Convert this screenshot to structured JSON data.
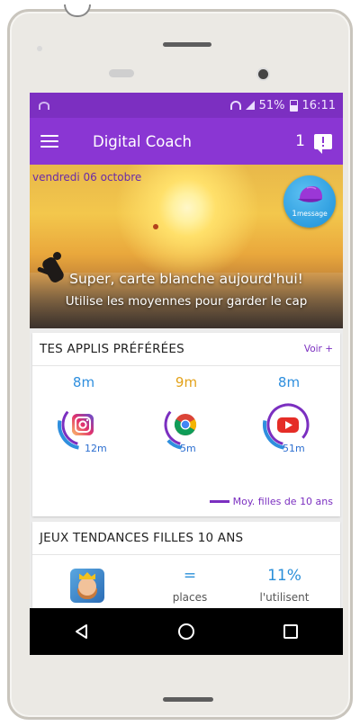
{
  "status_bar": {
    "time": "16:11",
    "battery": "51%"
  },
  "app_bar": {
    "title": "Digital Coach",
    "message_count": "1"
  },
  "hero": {
    "date": "vendredi 06 octobre",
    "badge_count": "1",
    "badge_label": "message",
    "headline": "Super, carte blanche aujourd'hui!",
    "subline": "Utilise les moyennes pour garder le cap"
  },
  "favorite_apps": {
    "title": "TES APPLIS PRÉFÉRÉES",
    "more_link": "Voir +",
    "apps": [
      {
        "icon": "instagram-icon",
        "average_time": "8m",
        "user_time": "12m",
        "avg_color": "#2f8fde",
        "avg_fraction": 0.35,
        "user_fraction": 0.6
      },
      {
        "icon": "chrome-icon",
        "average_time": "9m",
        "user_time": "5m",
        "avg_color": "#e3a21a",
        "avg_fraction": 0.35,
        "user_fraction": 0.25
      },
      {
        "icon": "youtube-icon",
        "average_time": "8m",
        "user_time": "51m",
        "avg_color": "#2f8fde",
        "avg_fraction": 0.9,
        "user_fraction": 0.6
      }
    ],
    "legend": "Moy. filles de 10 ans",
    "colors": {
      "accent": "#7b2fc0",
      "user_arc": "#2d6fd0",
      "self_arc": "#2f8fde"
    }
  },
  "trending_games": {
    "title": "JEUX TENDANCES FILLES 10 ANS",
    "rows": [
      {
        "icon": "clash-royale-icon",
        "places": "=",
        "places_label": "places",
        "usage": "11%",
        "usage_label": "l'utilisent"
      }
    ]
  },
  "nav": {
    "back": "back-icon",
    "home": "home-icon",
    "recents": "recents-icon"
  }
}
